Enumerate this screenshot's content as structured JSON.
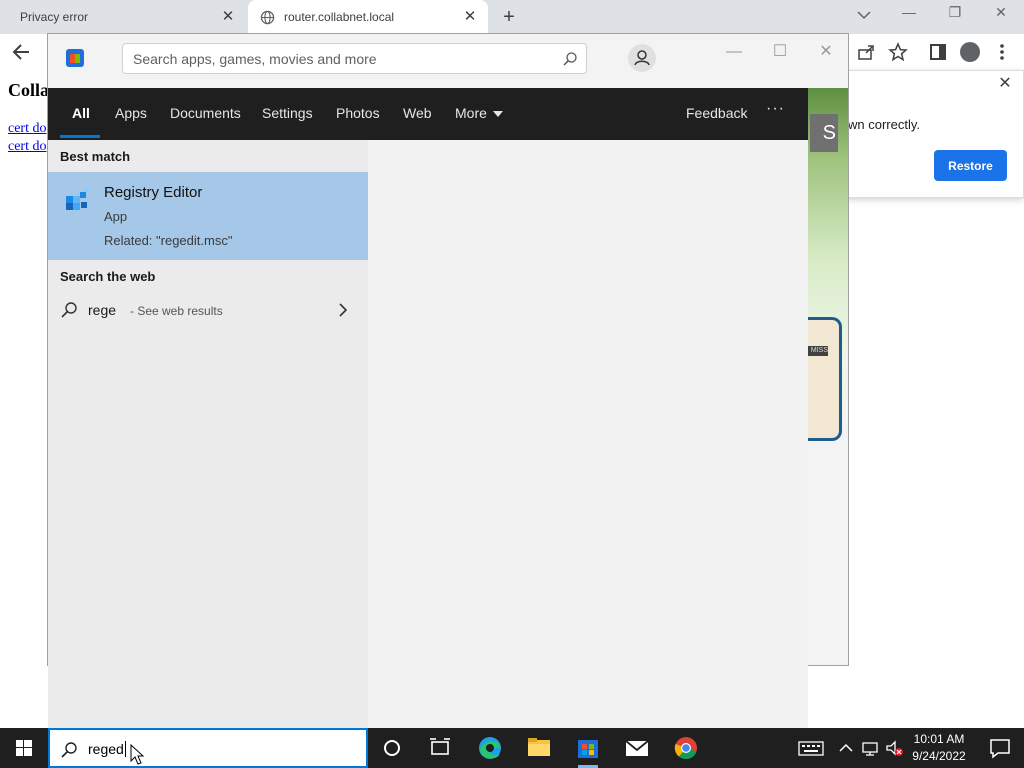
{
  "chrome": {
    "tabs": [
      {
        "title": "Privacy error"
      },
      {
        "title": "router.collabnet.local"
      }
    ],
    "page": {
      "heading": "Colla",
      "links": [
        "cert do",
        "cert do"
      ]
    },
    "restore_bubble": {
      "message": "wn correctly.",
      "button_label": "Restore"
    }
  },
  "store": {
    "search_placeholder": "Search apps, games, movies and more",
    "hero_badge": "S",
    "card_label": "MISS"
  },
  "search_panel": {
    "filters": [
      "All",
      "Apps",
      "Documents",
      "Settings",
      "Photos",
      "Web",
      "More"
    ],
    "active_filter": "All",
    "feedback_label": "Feedback",
    "options_label": "···",
    "best_match_heading": "Best match",
    "best_match": {
      "title": "Registry Editor",
      "subtitle": "App",
      "related": "Related: \"regedit.msc\""
    },
    "web_heading": "Search the web",
    "web_result": {
      "query": "rege",
      "hint": "- See web results"
    }
  },
  "taskbar": {
    "search_text": "reged",
    "clock_time": "10:01 AM",
    "clock_date": "9/24/2022"
  },
  "colors": {
    "accent": "#0078d7",
    "best_match_bg": "#a5c8e8",
    "chrome_blue": "#1a73e8",
    "taskbar": "#1f1f1f"
  }
}
